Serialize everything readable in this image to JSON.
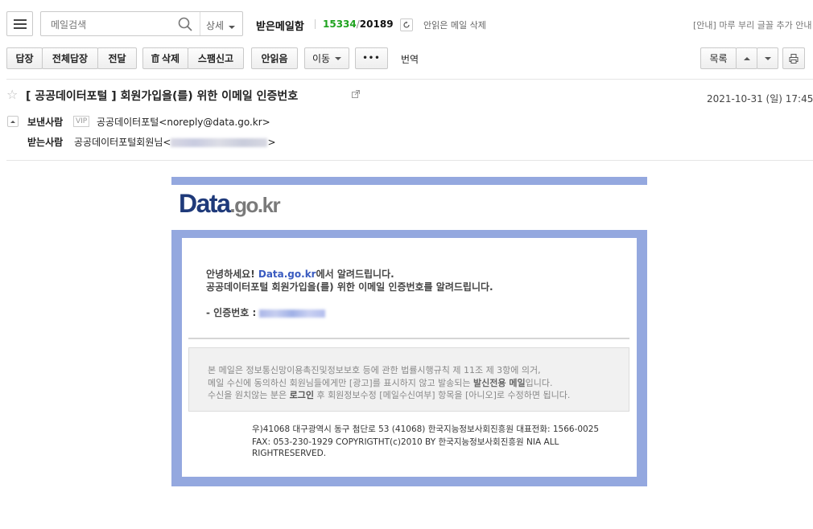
{
  "toolbar_top": {
    "search_placeholder": "메일검색",
    "detail_label": "상세",
    "folder_title": "받은메일함",
    "unread_count": "15334",
    "separator": "/",
    "total_count": "20189",
    "delete_unread_label": "안읽은 메일 삭제",
    "notice_text": "[안내] 마루 부리 글꼴 추가 안내"
  },
  "toolbar_actions": {
    "reply": "답장",
    "reply_all": "전체답장",
    "forward": "전달",
    "delete": "삭제",
    "spam": "스팸신고",
    "mark_unread": "안읽음",
    "move": "이동",
    "more": "•••",
    "translate": "번역",
    "list": "목록"
  },
  "mail": {
    "subject": "[ 공공데이터포털 ] 회원가입을(를) 위한 이메일 인증번호",
    "date": "2021-10-31 (일) 17:45",
    "sender_label": "보낸사람",
    "vip_badge": "VIP",
    "sender_name": "공공데이터포털",
    "sender_email": "<noreply@data.go.kr>",
    "recipient_label": "받는사람",
    "recipient_name": "공공데이터포털회원님<",
    "recipient_close": ">"
  },
  "body": {
    "logo_data": "Data",
    "logo_gokr": ".go.kr",
    "greeting_prefix": "안녕하세요! ",
    "greeting_site": "Data.go.kr",
    "greeting_suffix": "에서 알려드립니다.",
    "line2": "공공데이터포털 회원가입을(를) 위한 이메일 인증번호를 알려드립니다.",
    "code_label": "- 인증번호 : ",
    "notice_line1": "본 메일은 정보통신망이용촉진및정보보호 등에 관한 법률시행규칙 제 11조 제 3항에 의거,",
    "notice_line2_a": "메일 수신에 동의하신 회원님들에게만 [광고]를 표시하지 않고 발송되는 ",
    "notice_line2_b": "발신전용 메일",
    "notice_line2_c": "입니다.",
    "notice_line3_a": "수신을 원치않는 분은 ",
    "notice_line3_b": "로그인",
    "notice_line3_c": " 후 회원정보수정 [메일수신여부] 항목을 [아니오]로 수정하면 됩니다.",
    "footer_line1": "우)41068 대구광역시 동구 첨단로 53 (41068) 한국지능정보사회진흥원 대표전화: 1566-0025",
    "footer_line2": "FAX: 053-230-1929 COPYRIGTHT(c)2010 BY 한국지능정보사회진흥원 NIA ALL",
    "footer_line3": "RIGHTRESERVED."
  },
  "colors": {
    "accent_green": "#1fa31f",
    "frame_blue": "#94a8df",
    "link_blue": "#3a5bc0",
    "logo_navy": "#1f3a7a",
    "logo_gray": "#7a7a7a"
  }
}
